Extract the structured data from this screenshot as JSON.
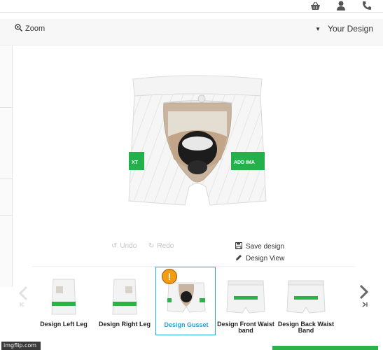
{
  "header": {
    "icons": [
      {
        "name": "basket-icon"
      },
      {
        "name": "user-icon"
      },
      {
        "name": "phone-icon"
      }
    ]
  },
  "toolbar": {
    "zoom_label": "Zoom",
    "design_label": "Your Design"
  },
  "actions": {
    "undo_label": "Undo",
    "redo_label": "Redo",
    "save_label": "Save design",
    "view_label": "Design View"
  },
  "product": {
    "left_sticker_text": "XT",
    "right_sticker_text": "ADD IMA"
  },
  "thumbnails": [
    {
      "label": "Design Left Leg",
      "active": false
    },
    {
      "label": "Design Right Leg",
      "active": false
    },
    {
      "label": "Design Gusset",
      "active": true,
      "warning": "!"
    },
    {
      "label": "Design Front Waist band",
      "active": false
    },
    {
      "label": "Design Back Waist Band",
      "active": false
    }
  ],
  "watermark": "imgflip.com",
  "colors": {
    "accent_green": "#2bb34a",
    "active_blue": "#2aa8d4",
    "warning_orange": "#f39c12"
  }
}
